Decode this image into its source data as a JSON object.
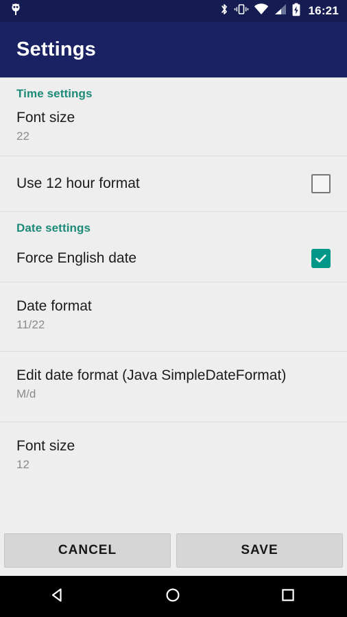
{
  "status_bar": {
    "notification_icon": "android-robot-icon",
    "icons": [
      "bluetooth-icon",
      "vibrate-icon",
      "wifi-icon",
      "cell-signal-icon",
      "battery-charging-icon"
    ],
    "clock": "16:21",
    "background_color": "#141c52"
  },
  "app_bar": {
    "title": "Settings",
    "background_color": "#1a2263",
    "text_color": "#ffffff"
  },
  "theme": {
    "accent_color": "#009688",
    "section_header_color": "#1c8a78",
    "list_background": "#eeeeee",
    "primary_text": "#1b1b1b",
    "secondary_text": "#8a8a8a",
    "divider_color": "#dcdcdc"
  },
  "sections": [
    {
      "header": "Time settings",
      "rows": [
        {
          "title": "Font size",
          "value": "22",
          "type": "value"
        },
        {
          "title": "Use 12 hour format",
          "checked": false,
          "type": "checkbox"
        }
      ]
    },
    {
      "header": "Date settings",
      "rows": [
        {
          "title": "Force English date",
          "checked": true,
          "type": "checkbox"
        },
        {
          "title": "Date format",
          "value": "11/22",
          "type": "value"
        },
        {
          "title": "Edit date format (Java SimpleDateFormat)",
          "value": "M/d",
          "type": "value"
        },
        {
          "title": "Font size",
          "value": "12",
          "type": "value"
        }
      ]
    }
  ],
  "buttons": {
    "cancel_label": "CANCEL",
    "save_label": "SAVE"
  },
  "nav_bar": {
    "back": "back-triangle-icon",
    "home": "home-circle-icon",
    "recents": "recents-square-icon",
    "background_color": "#000000"
  }
}
